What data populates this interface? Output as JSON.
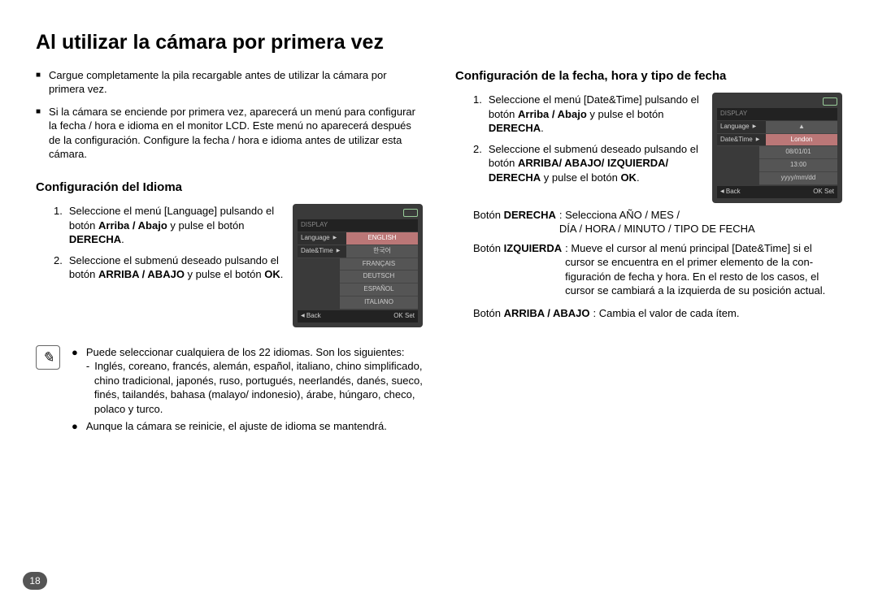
{
  "title": "Al utilizar la cámara por primera vez",
  "intro": {
    "b1": "Cargue completamente la pila recargable antes de utilizar la cámara por primera vez.",
    "b2": "Si la cámara se enciende por primera vez, aparecerá un menú para configurar la fecha / hora e idioma en el monitor LCD. Este menú no aparecerá después de la configuración. Configure la fecha / hora e idioma antes de utilizar esta cámara."
  },
  "lang": {
    "heading": "Configuración del Idioma",
    "s1a": "Seleccione el menú [Language] pulsando el botón ",
    "s1b": "Arriba / Abajo",
    "s1c": " y pulse el botón ",
    "s1d": "DERECHA",
    "s1e": ".",
    "s2a": "Seleccione el submenú deseado pulsando el botón ",
    "s2b": "ARRIBA / ABAJO",
    "s2c": " y pulse el botón ",
    "s2d": "OK",
    "s2e": "."
  },
  "lang_lcd": {
    "hdr": "DISPLAY",
    "r1l": "Language",
    "r1r": "ENGLISH",
    "r2l": "Date&Time",
    "r2r": "한국어",
    "r3": "FRANÇAIS",
    "r4": "DEUTSCH",
    "r5": "ESPAÑOL",
    "r6": "ITALIANO",
    "back": "Back",
    "okset": "OK Set"
  },
  "note": {
    "p1": "Puede seleccionar cualquiera de los 22 idiomas. Son los siguientes:",
    "p1l1": "Inglés, coreano, francés, alemán, español, italiano, chino simplificado,",
    "p1l2": "chino tradicional, japonés, ruso, portugués, neerlandés, danés, sueco,",
    "p1l3": "finés, tailandés, bahasa (malayo/ indonesio), árabe, húngaro, checo,",
    "p1l4": "polaco y turco.",
    "p2": "Aunque la cámara se reinicie, el ajuste de idioma se mantendrá."
  },
  "dt": {
    "heading": "Configuración de la fecha, hora y tipo de fecha",
    "s1a": "Seleccione el menú [Date&Time] pulsando el botón ",
    "s1b": "Arriba / Abajo",
    "s1c": " y pulse el botón ",
    "s1d": "DERECHA",
    "s1e": ".",
    "s2a": "Seleccione el submenú deseado pulsando el botón ",
    "s2b": "ARRIBA/ ABAJO/ IZQUIERDA/ DERECHA",
    "s2c": " y pulse el botón ",
    "s2d": "OK",
    "s2e": ".",
    "btn_r_k1": "Botón ",
    "btn_r_k2": "DERECHA",
    "btn_r_v1": ": Selecciona AÑO / MES /",
    "btn_r_v2": "DÍA / HORA / MINUTO / TIPO DE FECHA",
    "btn_l_k1": "Botón ",
    "btn_l_k2": "IZQUIERDA",
    "btn_l_v": " : Mueve el cursor al menú principal [Date&Time] si el cursor se encuentra en el primer elemento de la con-figuración de fecha y hora. En el resto de los casos, el cursor se cambiará a la izquierda de su posición actual.",
    "btn_ud_k1": "Botón ",
    "btn_ud_k2": "ARRIBA / ABAJO",
    "btn_ud_v": " : Cambia el valor de cada ítem."
  },
  "dt_lcd": {
    "hdr": "DISPLAY",
    "r1l": "Language",
    "r1r": "▲",
    "r2l": "Date&Time",
    "r2r": "London",
    "r3": "08/01/01",
    "r4": "13:00",
    "r5": "yyyy/mm/dd",
    "back": "Back",
    "okset": "OK Set"
  },
  "page_number": "18"
}
